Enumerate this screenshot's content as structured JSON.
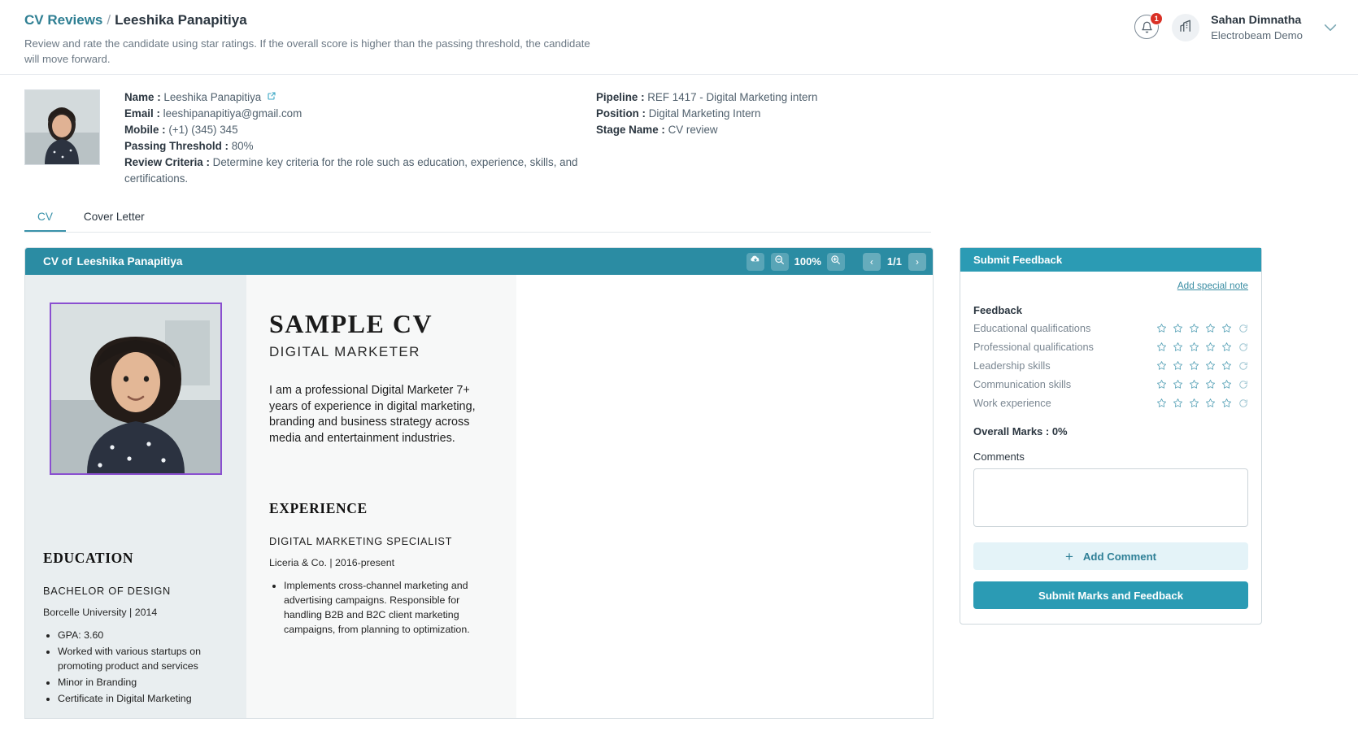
{
  "header": {
    "breadcrumb_root": "CV Reviews",
    "breadcrumb_separator": "/",
    "breadcrumb_leaf": "Leeshika Panapitiya",
    "subtitle": "Review and rate the candidate using star ratings. If the overall score is higher than the passing threshold, the candidate will move forward.",
    "notification_count": "1",
    "user_name": "Sahan Dimnatha",
    "user_org": "Electrobeam Demo"
  },
  "candidate": {
    "name_label": "Name :",
    "name_value": "Leeshika Panapitiya",
    "email_label": "Email :",
    "email_value": "leeshipanapitiya@gmail.com",
    "mobile_label": "Mobile :",
    "mobile_value": "(+1) (345) 345",
    "threshold_label": "Passing Threshold :",
    "threshold_value": "80%",
    "criteria_label": "Review Criteria :",
    "criteria_value": "Determine key criteria for the role such as education, experience, skills, and certifications.",
    "pipeline_label": "Pipeline :",
    "pipeline_value": "REF 1417 - Digital Marketing intern",
    "position_label": "Position :",
    "position_value": "Digital Marketing Intern",
    "stage_label": "Stage Name :",
    "stage_value": "CV review"
  },
  "tabs": [
    {
      "label": "CV",
      "active": true
    },
    {
      "label": "Cover Letter",
      "active": false
    }
  ],
  "viewer": {
    "title_prefix": "CV of",
    "title_name": "Leeshika Panapitiya",
    "zoom_level": "100%",
    "page_count": "1/1",
    "prev_glyph": "‹",
    "next_glyph": "›"
  },
  "cv_document": {
    "name": "SAMPLE CV",
    "role": "DIGITAL MARKETER",
    "summary": "I am a professional Digital Marketer 7+ years of experience in digital marketing, branding and business strategy across media and entertainment industries.",
    "education_heading": "EDUCATION",
    "education_title": "BACHELOR OF DESIGN",
    "education_sub": "Borcelle University | 2014",
    "education_bullets": [
      "GPA: 3.60",
      "Worked with various startups on promoting product and services",
      "Minor in Branding",
      "Certificate in Digital Marketing"
    ],
    "experience_heading": "EXPERIENCE",
    "experience_title": "DIGITAL MARKETING SPECIALIST",
    "experience_sub": "Liceria & Co. | 2016-present",
    "experience_bullets": [
      "Implements cross-channel marketing and advertising campaigns. Responsible for handling B2B and B2C client marketing campaigns, from planning to optimization."
    ]
  },
  "feedback": {
    "panel_title": "Submit Feedback",
    "special_note_link": "Add special note",
    "section_label": "Feedback",
    "criteria": [
      {
        "name": "Educational qualifications",
        "rating": 0
      },
      {
        "name": "Professional qualifications",
        "rating": 0
      },
      {
        "name": "Leadership skills",
        "rating": 0
      },
      {
        "name": "Communication skills",
        "rating": 0
      },
      {
        "name": "Work experience",
        "rating": 0
      }
    ],
    "max_stars": 5,
    "overall_marks": "Overall Marks : 0%",
    "comments_label": "Comments",
    "comment_value": "",
    "comment_placeholder": "",
    "add_comment_label": "Add Comment",
    "submit_label": "Submit Marks and Feedback"
  },
  "colors": {
    "accent_teal": "#2b9bb4",
    "header_teal": "#2b8ca3",
    "link_teal": "#3a8da3",
    "badge_red": "#d93025",
    "photo_border_purple": "#8a4fd0"
  }
}
